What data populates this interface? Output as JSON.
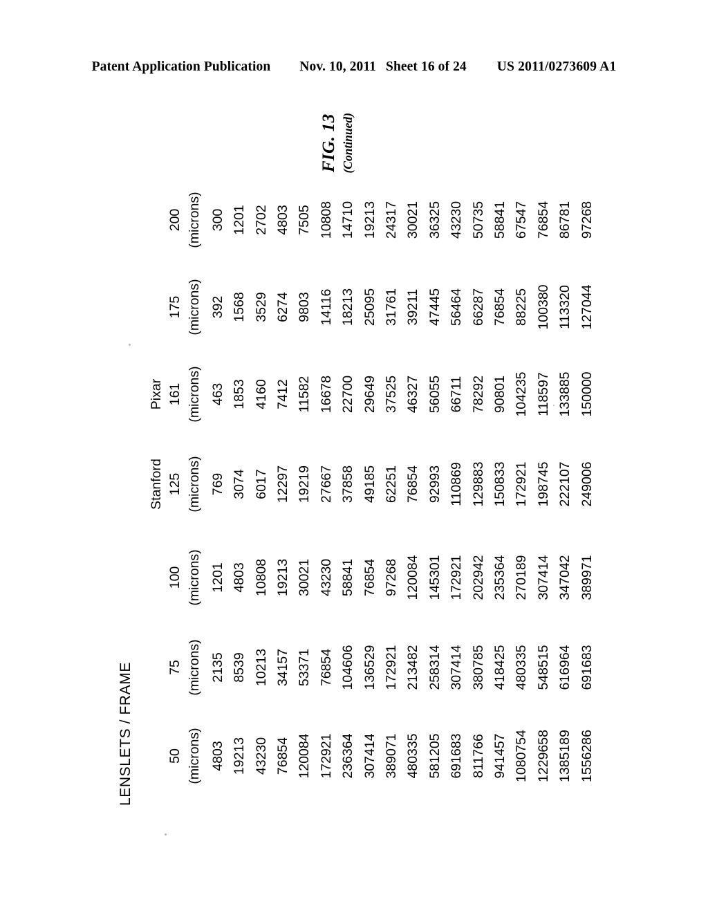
{
  "header": {
    "publication": "Patent Application Publication",
    "date": "Nov. 10, 2011",
    "sheet": "Sheet 16 of 24",
    "patent_number": "US 2011/0273609 A1"
  },
  "figure": {
    "title": "LENSLETS / FRAME",
    "caption_main": "FIG. 13",
    "caption_sub": "(Continued)"
  },
  "chart_data": {
    "type": "table",
    "title": "LENSLETS / FRAME",
    "group_labels": [
      "",
      "",
      "",
      "Stanford",
      "Pixar",
      "",
      ""
    ],
    "column_values": [
      "50",
      "75",
      "100",
      "125",
      "161",
      "175",
      "200"
    ],
    "column_units": [
      "(microns)",
      "(microns)",
      "(microns)",
      "(microns)",
      "(microns)",
      "(microns)",
      "(microns)"
    ],
    "columns": [
      "50 (microns)",
      "75 (microns)",
      "100 (microns)",
      "Stanford 125 (microns)",
      "Pixar 161 (microns)",
      "175 (microns)",
      "200 (microns)"
    ],
    "rows": [
      [
        "4803",
        "2135",
        "1201",
        "769",
        "463",
        "392",
        "300"
      ],
      [
        "19213",
        "8539",
        "4803",
        "3074",
        "1853",
        "1568",
        "1201"
      ],
      [
        "43230",
        "10213",
        "10808",
        "6017",
        "4160",
        "3529",
        "2702"
      ],
      [
        "76854",
        "34157",
        "19213",
        "12297",
        "7412",
        "6274",
        "4803"
      ],
      [
        "120084",
        "53371",
        "30021",
        "19219",
        "11582",
        "9803",
        "7505"
      ],
      [
        "172921",
        "76854",
        "43230",
        "27667",
        "16678",
        "14116",
        "10808"
      ],
      [
        "236364",
        "104606",
        "58841",
        "37858",
        "22700",
        "18213",
        "14710"
      ],
      [
        "307414",
        "136529",
        "76854",
        "49185",
        "29649",
        "25095",
        "19213"
      ],
      [
        "389071",
        "172921",
        "97268",
        "62251",
        "37525",
        "31761",
        "24317"
      ],
      [
        "480335",
        "213482",
        "120084",
        "76854",
        "46327",
        "39211",
        "30021"
      ],
      [
        "581205",
        "258314",
        "145301",
        "92993",
        "56055",
        "47445",
        "36325"
      ],
      [
        "691683",
        "307414",
        "172921",
        "110869",
        "66711",
        "56464",
        "43230"
      ],
      [
        "811766",
        "380785",
        "202942",
        "129883",
        "78292",
        "66287",
        "50735"
      ],
      [
        "941457",
        "418425",
        "235364",
        "150833",
        "90801",
        "76854",
        "58841"
      ],
      [
        "1080754",
        "480335",
        "270189",
        "172921",
        "104235",
        "88225",
        "67547"
      ],
      [
        "1229658",
        "548515",
        "307414",
        "198745",
        "118597",
        "100380",
        "76854"
      ],
      [
        "1385189",
        "616964",
        "347042",
        "222107",
        "133885",
        "113320",
        "86781"
      ],
      [
        "1556286",
        "691683",
        "389971",
        "249006",
        "150000",
        "127044",
        "97268"
      ]
    ]
  }
}
